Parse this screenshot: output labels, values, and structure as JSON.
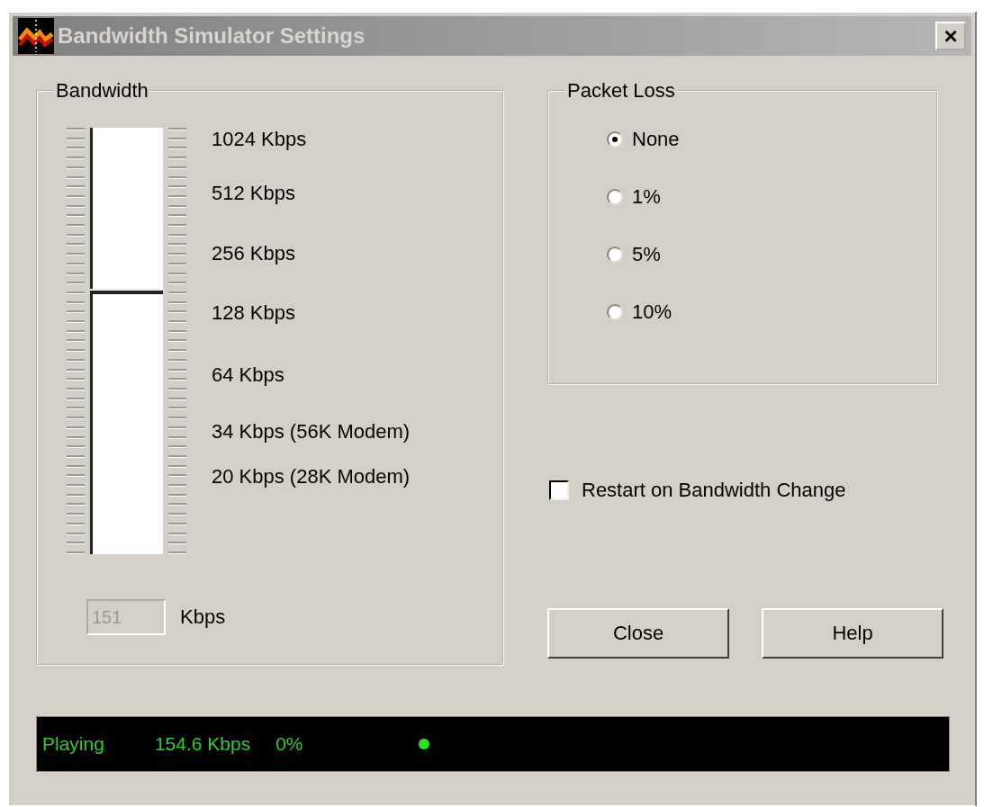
{
  "window": {
    "title": "Bandwidth Simulator Settings",
    "close": "×"
  },
  "bandwidth": {
    "title": "Bandwidth",
    "slider": {
      "level": 0.61
    },
    "scale_labels": [
      "1024 Kbps",
      "512 Kbps",
      "256 Kbps",
      "128 Kbps",
      "64 Kbps",
      "34 Kbps (56K Modem)",
      "20 Kbps (28K Modem)"
    ],
    "field": {
      "value": "151",
      "disabled": true
    },
    "unit": "Kbps"
  },
  "packet_loss": {
    "title": "Packet Loss",
    "options": [
      {
        "label": "None",
        "selected": true
      },
      {
        "label": "1%",
        "selected": false
      },
      {
        "label": "5%",
        "selected": false
      },
      {
        "label": "10%",
        "selected": false
      }
    ]
  },
  "restart_checkbox": {
    "label": "Restart on Bandwidth Change",
    "checked": false
  },
  "buttons": [
    "Close",
    "Help"
  ],
  "status_bar": {
    "state": "Playing",
    "rate": "154.6 Kbps",
    "loss": "0%"
  }
}
